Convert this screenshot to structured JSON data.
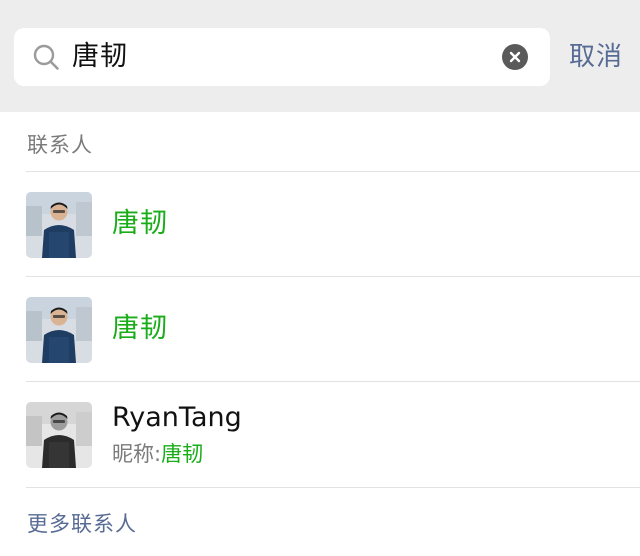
{
  "search": {
    "value": "唐韧",
    "cancel_label": "取消"
  },
  "contacts_section": {
    "title": "联系人",
    "items": [
      {
        "name": "唐韧"
      },
      {
        "name": "唐韧"
      },
      {
        "name": "RyanTang",
        "nickname_label": "昵称:",
        "nickname": "唐韧"
      }
    ],
    "more_label": "更多联系人"
  },
  "colors": {
    "highlight": "#1aad19",
    "link": "#576b95",
    "header_bg": "#ededed"
  }
}
